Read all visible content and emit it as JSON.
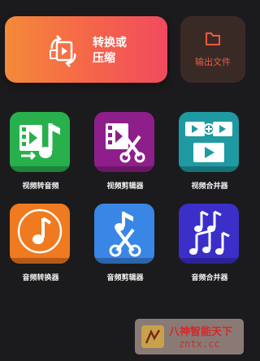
{
  "convert": {
    "label_line1": "转换或",
    "label_line2": "压缩",
    "icon": "convert-files-icon"
  },
  "export": {
    "label": "输出文件",
    "icon": "folder-icon",
    "color": "#ee5a3e"
  },
  "tools": [
    {
      "label": "视频转音频",
      "icon": "video-to-audio-icon",
      "color": "#27b04c"
    },
    {
      "label": "视频剪辑器",
      "icon": "video-cutter-icon",
      "color": "#8e1f8a"
    },
    {
      "label": "视频合并器",
      "icon": "video-merger-icon",
      "color": "#1f9aa3"
    },
    {
      "label": "音频转换器",
      "icon": "audio-converter-icon",
      "color": "#f07a1f"
    },
    {
      "label": "音频剪辑器",
      "icon": "audio-cutter-icon",
      "color": "#3a86e6"
    },
    {
      "label": "音频合并器",
      "icon": "audio-merger-icon",
      "color": "#3b2fc9"
    }
  ],
  "watermark": {
    "line1": "八神智能天下",
    "line2": "zntx.cc"
  }
}
